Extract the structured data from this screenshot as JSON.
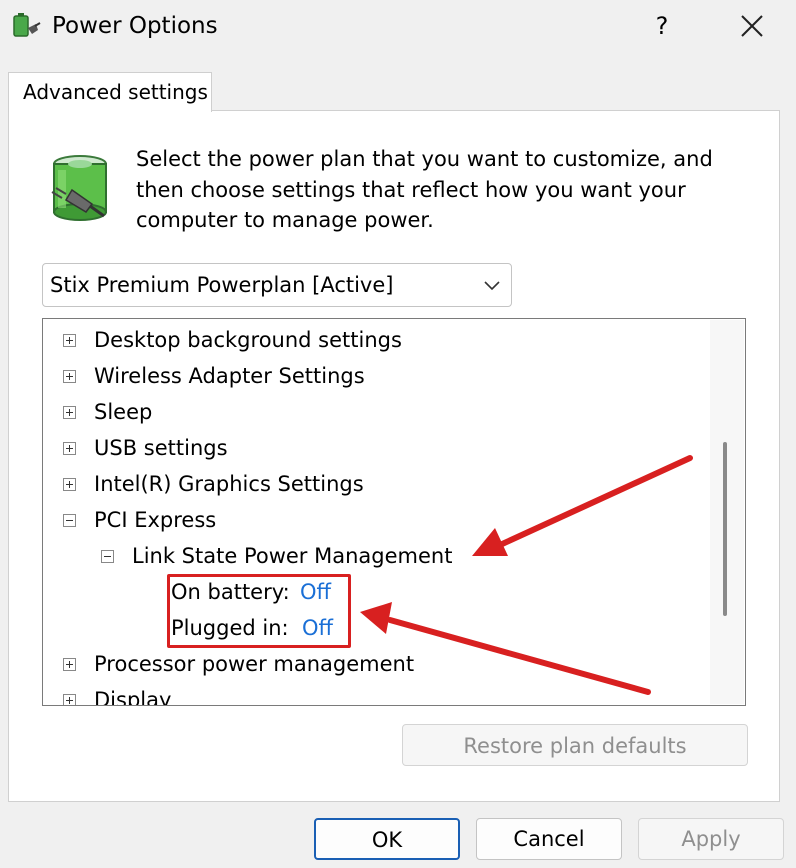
{
  "window": {
    "title": "Power Options",
    "help_label": "?"
  },
  "tabs": [
    {
      "label": "Advanced settings",
      "active": true
    }
  ],
  "description": "Select the power plan that you want to customize, and then choose settings that reflect how you want your computer to manage power.",
  "plan_select": {
    "value": "Stix Premium Powerplan [Active]"
  },
  "tree": {
    "items": [
      {
        "label": "Desktop background settings",
        "expanded": false
      },
      {
        "label": "Wireless Adapter Settings",
        "expanded": false
      },
      {
        "label": "Sleep",
        "expanded": false
      },
      {
        "label": "USB settings",
        "expanded": false
      },
      {
        "label": "Intel(R) Graphics Settings",
        "expanded": false
      },
      {
        "label": "PCI Express",
        "expanded": true
      },
      {
        "label": "Link State Power Management",
        "expanded": true
      },
      {
        "label": "On battery:",
        "value": "Off"
      },
      {
        "label": "Plugged in:",
        "value": "Off"
      },
      {
        "label": "Processor power management",
        "expanded": false
      },
      {
        "label": "Display",
        "expanded": false
      }
    ]
  },
  "buttons": {
    "restore": "Restore plan defaults",
    "ok": "OK",
    "cancel": "Cancel",
    "apply": "Apply"
  },
  "colors": {
    "accent": "#1a5fb4",
    "setting_value": "#1a6fd6",
    "annotation": "#d82020"
  },
  "icons": {
    "app": "power-options-icon",
    "header": "battery-plug-icon",
    "close": "close-icon",
    "chevron": "chevron-down-icon"
  }
}
